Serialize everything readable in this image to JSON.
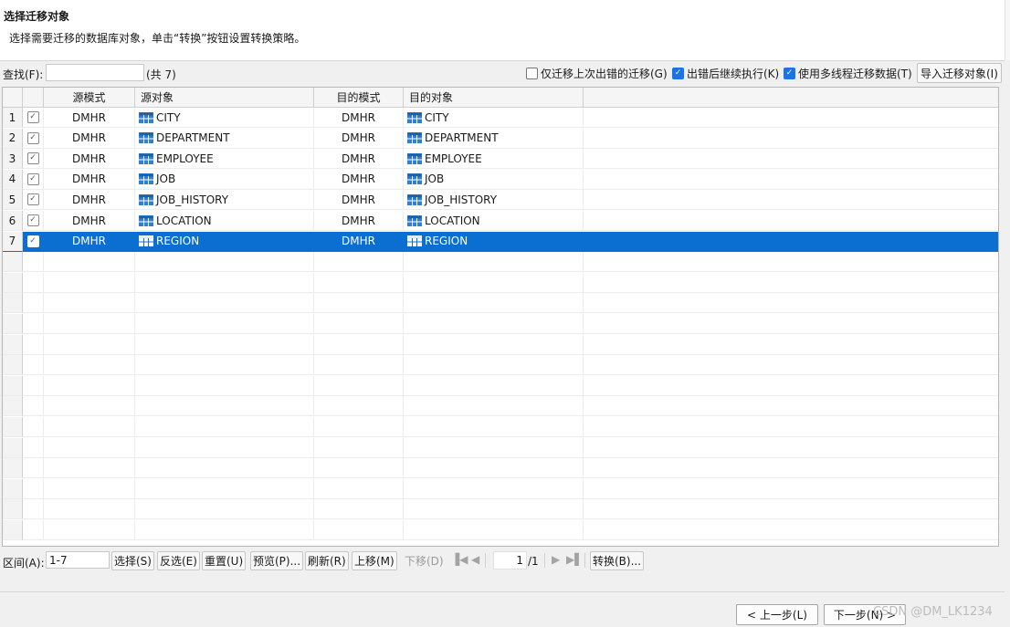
{
  "header": {
    "title": "选择迁移对象",
    "description": "选择需要迁移的数据库对象，单击“转换”按钮设置转换策略。"
  },
  "toolbar": {
    "find_label": "查找(F):",
    "find_value": "",
    "count_text": "(共 7)",
    "options": [
      {
        "label": "仅迁移上次出错的迁移(G)",
        "checked": false
      },
      {
        "label": "出错后继续执行(K)",
        "checked": true
      },
      {
        "label": "使用多线程迁移数据(T)",
        "checked": true
      }
    ],
    "import_label": "导入迁移对象(I)"
  },
  "table": {
    "columns": [
      "源模式",
      "源对象",
      "目的模式",
      "目的对象"
    ],
    "rows": [
      {
        "num": "1",
        "checked": true,
        "src_schema": "DMHR",
        "src_obj": "CITY",
        "dst_schema": "DMHR",
        "dst_obj": "CITY",
        "selected": false
      },
      {
        "num": "2",
        "checked": true,
        "src_schema": "DMHR",
        "src_obj": "DEPARTMENT",
        "dst_schema": "DMHR",
        "dst_obj": "DEPARTMENT",
        "selected": false
      },
      {
        "num": "3",
        "checked": true,
        "src_schema": "DMHR",
        "src_obj": "EMPLOYEE",
        "dst_schema": "DMHR",
        "dst_obj": "EMPLOYEE",
        "selected": false
      },
      {
        "num": "4",
        "checked": true,
        "src_schema": "DMHR",
        "src_obj": "JOB",
        "dst_schema": "DMHR",
        "dst_obj": "JOB",
        "selected": false
      },
      {
        "num": "5",
        "checked": true,
        "src_schema": "DMHR",
        "src_obj": "JOB_HISTORY",
        "dst_schema": "DMHR",
        "dst_obj": "JOB_HISTORY",
        "selected": false
      },
      {
        "num": "6",
        "checked": true,
        "src_schema": "DMHR",
        "src_obj": "LOCATION",
        "dst_schema": "DMHR",
        "dst_obj": "LOCATION",
        "selected": false
      },
      {
        "num": "7",
        "checked": true,
        "src_schema": "DMHR",
        "src_obj": "REGION",
        "dst_schema": "DMHR",
        "dst_obj": "REGION",
        "selected": true
      }
    ],
    "selection_color": "#0a6fd1",
    "table_icon_color": "#2f80d1"
  },
  "bottom": {
    "range_label": "区间(A):",
    "range_value": "1-7",
    "select_btn": "选择(S)",
    "invert_btn": "反选(E)",
    "reset_btn": "重置(U)",
    "preview_btn": "预览(P)...",
    "refresh_btn": "刷新(R)",
    "up_btn": "上移(M)",
    "down_btn": "下移(D)",
    "page_value": "1",
    "page_total": "/1",
    "convert_btn": "转换(B)..."
  },
  "footer": {
    "prev_btn": "< 上一步(L)",
    "next_btn": "下一步(N) >",
    "watermark": "CSDN @DM_LK1234"
  }
}
